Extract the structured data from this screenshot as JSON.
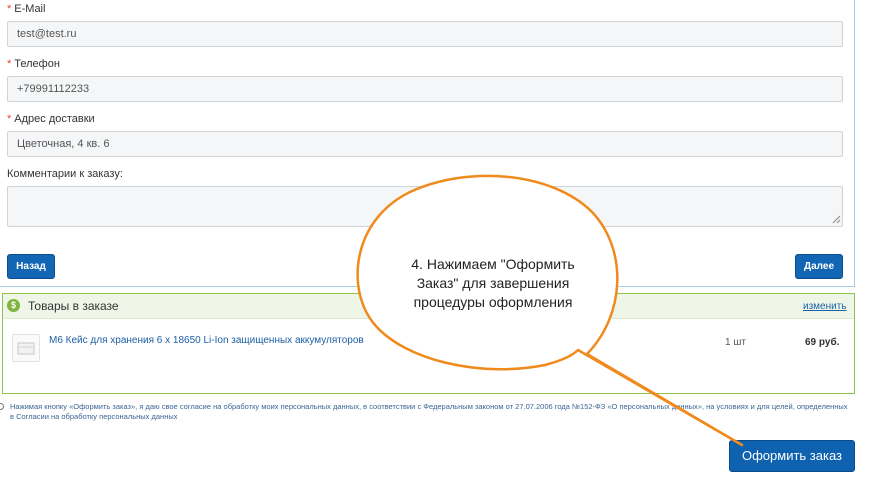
{
  "form": {
    "email": {
      "label": "E-Mail",
      "value": "test@test.ru",
      "required": "*"
    },
    "phone": {
      "label": "Телефон",
      "value": "+79991112233",
      "required": "*"
    },
    "address": {
      "label": "Адрес доставки",
      "value": "Цветочная, 4 кв. 6",
      "required": "*"
    },
    "comment": {
      "label": "Комментарии к заказу:",
      "value": ""
    },
    "back_label": "Назад",
    "next_label": "Далее"
  },
  "order": {
    "icon_glyph": "$",
    "title": "Товары в заказе",
    "edit_label": "изменить",
    "items": [
      {
        "name": "M6 Кейс для хранения 6 х 18650 Li-Ion защищенных аккумуляторов",
        "qty": "1 шт",
        "price": "69 руб."
      }
    ]
  },
  "consent_text": "Нажимая кнопку «Оформить заказ», я даю свое согласие на обработку моих персональных данных, в соответствии с Федеральным законом от 27.07.2006 года №152-ФЗ «О персональных данных», на условиях и для целей, определенных в Согласии на обработку персональных данных",
  "submit_label": "Оформить заказ",
  "callout": {
    "text": "4. Нажимаем \"Оформить Заказ\" для завершения процедуры оформления"
  },
  "colors": {
    "primary_button": "#0f62b0",
    "order_border": "#8fc24f",
    "callout_border": "#f08a1c",
    "required": "#e34234"
  }
}
